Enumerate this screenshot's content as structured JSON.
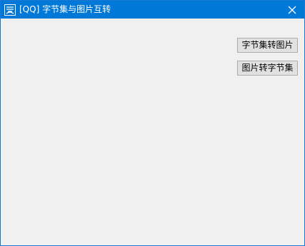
{
  "window": {
    "title": "[QQ] 字节集与图片互转",
    "app_icon": "app-logo-icon",
    "close_icon": "close-icon",
    "accent_color": "#0078d7"
  },
  "buttons": {
    "bytes_to_image": "字节集转图片",
    "image_to_bytes": "图片转字节集"
  }
}
